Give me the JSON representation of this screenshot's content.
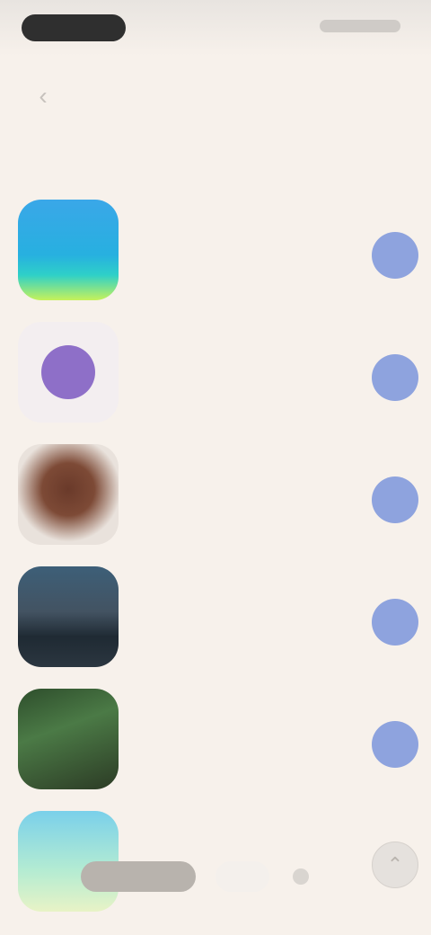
{
  "status": {
    "time": "",
    "icons": "signal-wifi-battery"
  },
  "header": {
    "back_icon": "chevron-left-icon",
    "title": "",
    "action": ""
  },
  "section": {
    "title": "",
    "see_all": ""
  },
  "apps": [
    {
      "name": "",
      "subtitle": "",
      "icon": "app-icon-blue-gradient"
    },
    {
      "name": "",
      "subtitle": "",
      "icon": "app-icon-purple-dot"
    },
    {
      "name": "",
      "subtitle": "",
      "icon": "app-icon-brown-round"
    },
    {
      "name": "",
      "subtitle": "",
      "icon": "app-icon-dark-landscape"
    },
    {
      "name": "",
      "subtitle": "",
      "icon": "app-icon-green-forest"
    },
    {
      "name": "",
      "subtitle": "",
      "icon": "app-icon-light-map"
    }
  ],
  "nav": {
    "primary": "",
    "secondary": ""
  },
  "colors": {
    "background": "#f7f1eb",
    "accent": "#8ea3de"
  }
}
